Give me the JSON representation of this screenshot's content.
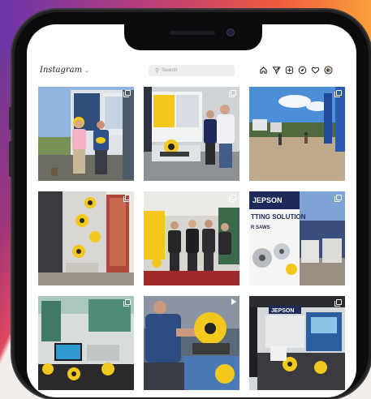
{
  "app": {
    "logo_text": "Instagram",
    "logo_caret": "⌄"
  },
  "search": {
    "placeholder": "Search",
    "icon": "search-icon"
  },
  "nav_icons": [
    "home-icon",
    "direct-icon",
    "new-post-icon",
    "explore-icon",
    "activity-icon",
    "heart-icon",
    "profile-icon"
  ],
  "colors": {
    "brand_yellow": "#f2c81c",
    "brand_navy": "#1d2a5a",
    "gradient": [
      "#6a35a9",
      "#b93d7a",
      "#ef5a3f",
      "#f9a03a"
    ]
  },
  "posts": [
    {
      "alt": "photo-two-men-in-front-of-trailer",
      "badge": "multi"
    },
    {
      "alt": "photo-trade-show-display-with-saw",
      "badge": "multi"
    },
    {
      "alt": "photo-outdoor-fair-grounds",
      "badge": "multi"
    },
    {
      "alt": "photo-product-wall-display",
      "badge": "multi"
    },
    {
      "alt": "photo-team-at-booth",
      "badge": "multi"
    },
    {
      "alt": "photo-cutting-solutions-banner",
      "badge": "multi"
    },
    {
      "alt": "photo-booth-with-screens",
      "badge": "multi"
    },
    {
      "alt": "photo-man-demonstrating-saw",
      "badge": "reel"
    },
    {
      "alt": "photo-booth-with-blue-display",
      "badge": "multi"
    }
  ],
  "tile_texts": {
    "banner_brand": "JEPSON",
    "banner_line": "TTING SOLUTION",
    "banner_sub": "R SAWS",
    "booth_banner": "JEPSON"
  }
}
